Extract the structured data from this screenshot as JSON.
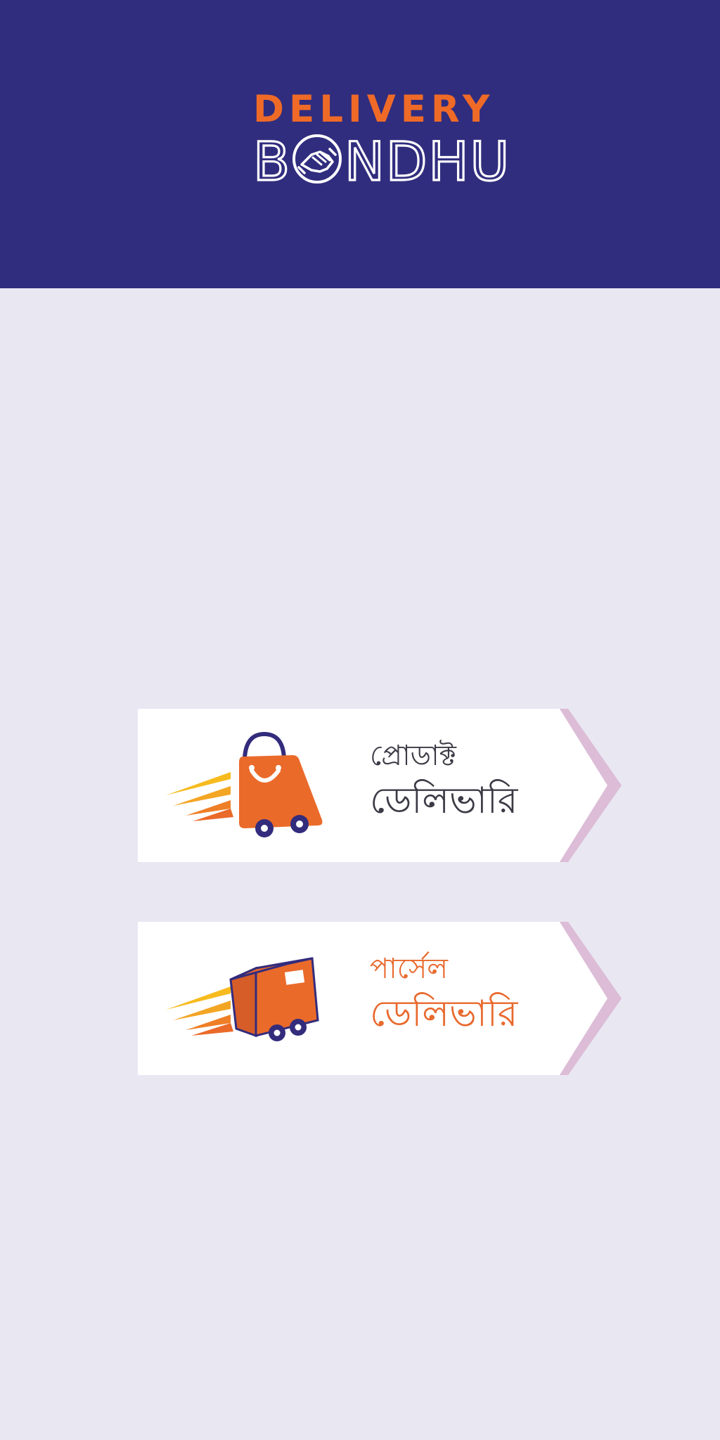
{
  "brand": {
    "line1": "DELIVERY",
    "line2": "BONDHU",
    "line2_before_icon": "B",
    "line2_after_icon": "NDHU",
    "header_color": "#312d7e",
    "accent_color": "#ef6a27"
  },
  "options": [
    {
      "line1": "প্রোডাক্ট",
      "line2": "ডেলিভারি",
      "icon": "shopping-bag-cart-icon",
      "text_color": "#3c3a45"
    },
    {
      "line1": "পার্সেল",
      "line2": "ডেলিভারি",
      "icon": "parcel-box-icon",
      "text_color": "#e8692d"
    }
  ],
  "colors": {
    "background": "#e9e7f2",
    "card": "#ffffff",
    "arrow_shadow": "#d9b8d6",
    "icon_orange": "#ea6a2a",
    "icon_navy": "#332c7c",
    "speed_yellow": "#f7bb1e"
  }
}
